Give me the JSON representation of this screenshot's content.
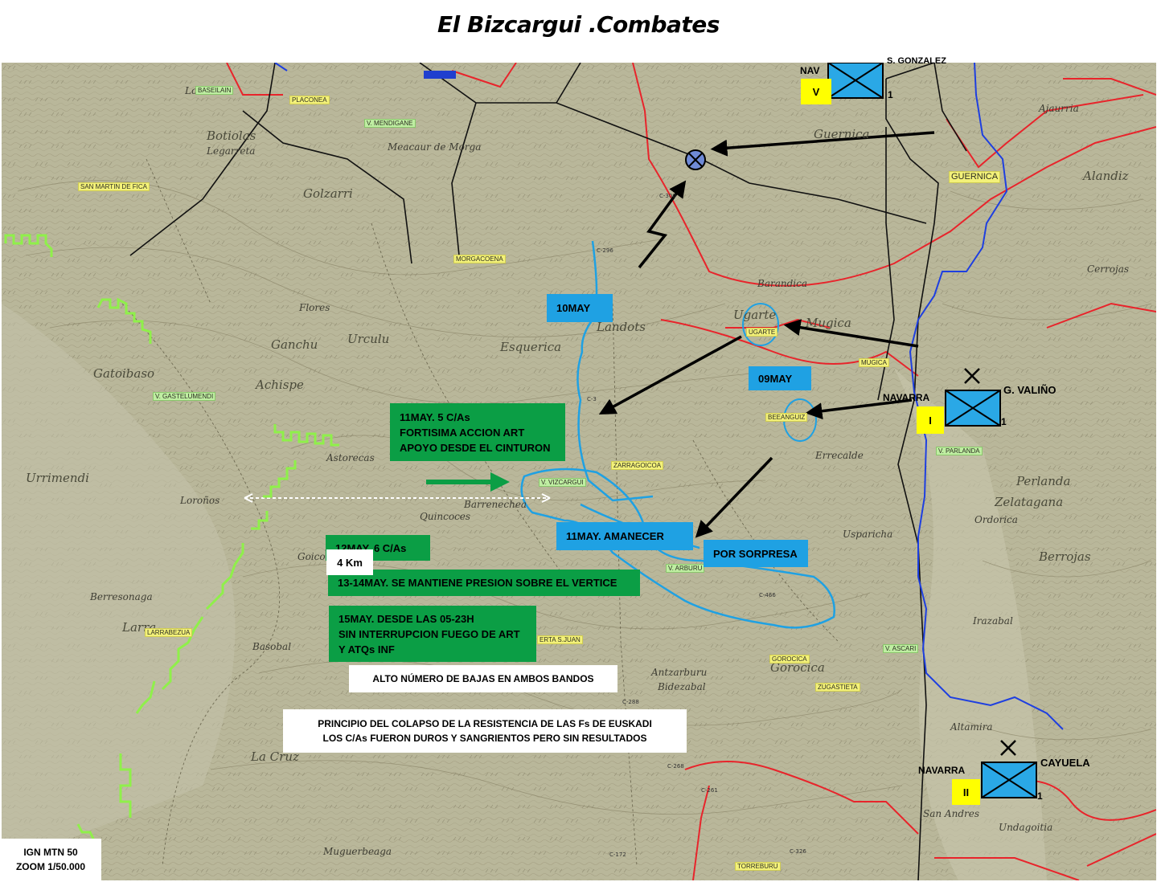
{
  "title": "El Bizcargui .Combates",
  "places": [
    {
      "name": "Lotina"
    },
    {
      "name": "Botiolas"
    },
    {
      "name": "Legarreta"
    },
    {
      "name": "Meacaur de Morga"
    },
    {
      "name": "Golzarri"
    },
    {
      "name": "Ganchu"
    },
    {
      "name": "Urculu"
    },
    {
      "name": "Gatoibaso"
    },
    {
      "name": "Achispe"
    },
    {
      "name": "Landots"
    },
    {
      "name": "Esquerica"
    },
    {
      "name": "Astorecas"
    },
    {
      "name": "Barrenechea"
    },
    {
      "name": "Loroños"
    },
    {
      "name": "Urrimendi"
    },
    {
      "name": "Quincoces"
    },
    {
      "name": "Basobal"
    },
    {
      "name": "Berresonaga"
    },
    {
      "name": "Larra"
    },
    {
      "name": "Goicoechea"
    },
    {
      "name": "Antzarburu"
    },
    {
      "name": "Bidezabal"
    },
    {
      "name": "Gorocica"
    },
    {
      "name": "La Cruz"
    },
    {
      "name": "Muguerbeaga"
    },
    {
      "name": "Ugarte"
    },
    {
      "name": "Mugica"
    },
    {
      "name": "Alandiz"
    },
    {
      "name": "Perlanda"
    },
    {
      "name": "Zelatagana"
    },
    {
      "name": "Ordorica"
    },
    {
      "name": "Berrojas"
    },
    {
      "name": "Irazabal"
    },
    {
      "name": "Altamira"
    },
    {
      "name": "San Andres"
    },
    {
      "name": "Undagoitia"
    },
    {
      "name": "Guernica"
    },
    {
      "name": "Ajaurria"
    },
    {
      "name": "Cerrojas"
    },
    {
      "name": "Flores"
    },
    {
      "name": "Barandica"
    },
    {
      "name": "Usparicha"
    },
    {
      "name": "Errecalde"
    }
  ],
  "tags": [
    {
      "text": "BASEILAIN",
      "style": "green"
    },
    {
      "text": "PLACONEA",
      "style": "yellow"
    },
    {
      "text": "V. MENDIGANE",
      "style": "green"
    },
    {
      "text": "SAN MARTIN DE FICA",
      "style": "yellow"
    },
    {
      "text": "MORGACOENA",
      "style": "yellow"
    },
    {
      "text": "UGARTE",
      "style": "yellow"
    },
    {
      "text": "MUGICA",
      "style": "yellow"
    },
    {
      "text": "GUERNICA",
      "style": "yellow"
    },
    {
      "text": "V. GASTELUMENDI",
      "style": "green"
    },
    {
      "text": "BEEANGUIZ",
      "style": "yellow"
    },
    {
      "text": "V. PARLANDA",
      "style": "green"
    },
    {
      "text": "ZARRAGOICOA",
      "style": "yellow"
    },
    {
      "text": "V. VIZCARGUI",
      "style": "green"
    },
    {
      "text": "V. ARBURU",
      "style": "green"
    },
    {
      "text": "LARRABEZUA",
      "style": "yellow"
    },
    {
      "text": "ERTA S.JUAN",
      "style": "yellow"
    },
    {
      "text": "V. ASCARI",
      "style": "green"
    },
    {
      "text": "GOROCICA",
      "style": "yellow"
    },
    {
      "text": "ZUGASTIETA",
      "style": "yellow"
    },
    {
      "text": "TORREBURU",
      "style": "yellow"
    },
    {
      "text": "C-300",
      "style": "hwy"
    },
    {
      "text": "C-296",
      "style": "hwy"
    },
    {
      "text": "C-3",
      "style": "hwy"
    },
    {
      "text": "C-466",
      "style": "hwy"
    },
    {
      "text": "C-268",
      "style": "hwy"
    },
    {
      "text": "C-261",
      "style": "hwy"
    },
    {
      "text": "C-288",
      "style": "hwy"
    },
    {
      "text": "C-326",
      "style": "hwy"
    },
    {
      "text": "C-172",
      "style": "hwy"
    }
  ],
  "events": {
    "may10": "10MAY",
    "may09": "09MAY",
    "may11_art": [
      "11MAY.  5 C/As",
      "FORTISIMA ACCION ART",
      "APOYO DESDE EL CINTURON"
    ],
    "may11_dawn": "11MAY.  AMANECER",
    "surprise": "POR SORPRESA",
    "may12": "12MAY.  6 C/As",
    "may13_14": "13-14MAY.  SE MANTIENE PRESION SOBRE EL VERTICE",
    "may15": [
      "15MAY.  DESDE LAS 05-23H",
      "SIN INTERRUPCION FUEGO DE ART",
      "Y ATQs INF"
    ],
    "casualties": "ALTO NÚMERO DE BAJAS EN AMBOS BANDOS",
    "collapse": [
      "PRINCIPIO DEL COLAPSO DE LA RESISTENCIA DE LAS Fs DE EUSKADI",
      "LOS C/As FUERON DUROS Y SANGRIENTOS PERO SIN RESULTADOS"
    ]
  },
  "scale": {
    "distance": "4 Km"
  },
  "units": [
    {
      "formation": "NAV",
      "brigade": "V",
      "commander": "S. GONZALEZ",
      "number": "1"
    },
    {
      "formation": "NAVARRA",
      "brigade": "I",
      "commander": "G. VALIÑO",
      "number": "1"
    },
    {
      "formation": "NAVARRA",
      "brigade": "II",
      "commander": "CAYUELA",
      "number": "1"
    }
  ],
  "source": [
    "IGN MTN 50",
    "ZOOM 1/50.000"
  ],
  "colors": {
    "map_bg": "#b9b79a",
    "unit_fill": "#2aa8e6",
    "brigade_badge": "#ffff00",
    "event_green": "#0b9e45",
    "event_blue": "#1fa1e3",
    "front_line": "#8ff04a",
    "border_red": "#e8242b",
    "river_blue": "#1e3fe0",
    "sector_blue": "#1fa1e3"
  },
  "icons": [
    "crossed-circle-objective-icon",
    "infantry-unit-icon",
    "attack-arrow-icon",
    "front-line-icon"
  ]
}
